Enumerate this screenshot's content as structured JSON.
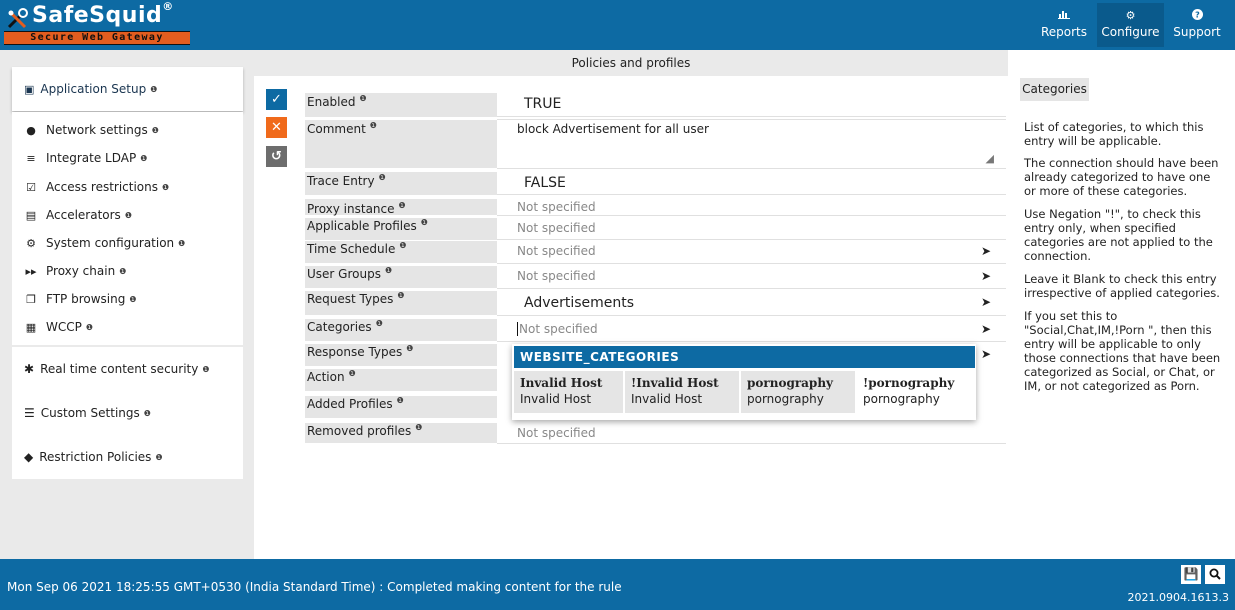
{
  "header": {
    "brand": "SafeSquid",
    "brand_mark": "®",
    "tagline": "Secure Web Gateway",
    "nav": [
      {
        "label": "Reports",
        "icon": "chart-icon"
      },
      {
        "label": "Configure",
        "icon": "gears-icon"
      },
      {
        "label": "Support",
        "icon": "question-icon"
      }
    ]
  },
  "sidebar": {
    "section_application": "Application Setup",
    "items": [
      {
        "label": "Network settings",
        "icon": "globe-icon"
      },
      {
        "label": "Integrate LDAP",
        "icon": "list-icon"
      },
      {
        "label": "Access restrictions",
        "icon": "checkbox-icon"
      },
      {
        "label": "Accelerators",
        "icon": "server-icon"
      },
      {
        "label": "System configuration",
        "icon": "gear-icon"
      },
      {
        "label": "Proxy chain",
        "icon": "forward-icon"
      },
      {
        "label": "FTP browsing",
        "icon": "files-icon"
      },
      {
        "label": "WCCP",
        "icon": "keyboard-icon"
      }
    ],
    "section_realtime": "Real time content security",
    "section_custom": "Custom Settings",
    "section_restriction": "Restriction Policies",
    "info_mark": "❶"
  },
  "main": {
    "title": "Policies and profiles",
    "fields": {
      "enabled": {
        "label": "Enabled",
        "value": "TRUE"
      },
      "comment": {
        "label": "Comment",
        "value": "block Advertisement for all user"
      },
      "trace": {
        "label": "Trace Entry",
        "value": "FALSE"
      },
      "proxy_instance": {
        "label": "Proxy instance",
        "value": "Not specified"
      },
      "applicable_profiles": {
        "label": "Applicable Profiles",
        "value": "Not specified"
      },
      "time_schedule": {
        "label": "Time Schedule",
        "value": "Not specified"
      },
      "user_groups": {
        "label": "User Groups",
        "value": "Not specified"
      },
      "request_types": {
        "label": "Request Types",
        "value": "Advertisements"
      },
      "categories": {
        "label": "Categories",
        "placeholder": "Not specified"
      },
      "response_types": {
        "label": "Response Types",
        "value": ""
      },
      "action": {
        "label": "Action",
        "value": ""
      },
      "added_profiles": {
        "label": "Added Profiles",
        "value": ""
      },
      "removed_profiles": {
        "label": "Removed profiles",
        "value": "Not specified"
      }
    },
    "dropdown": {
      "header": "WEBSITE_CATEGORIES",
      "options": [
        {
          "title": "Invalid Host",
          "subtitle": "Invalid Host"
        },
        {
          "title": "!Invalid Host",
          "subtitle": "Invalid Host"
        },
        {
          "title": "pornography",
          "subtitle": "pornography"
        },
        {
          "title": "!pornography",
          "subtitle": "pornography"
        }
      ]
    }
  },
  "help": {
    "tab": "Categories",
    "paragraphs": [
      "List of categories, to which this entry will be applicable.",
      "The connection should have been already categorized to have one or more of these categories.",
      "Use Negation \"!\", to check this entry only, when specified categories are not applied to the connection.",
      "Leave it Blank to check this entry irrespective of applied categories.",
      "If you set this to \"Social,Chat,IM,!Porn \", then this entry will be applicable to only those connections that have been categorized as Social, or Chat, or IM, or not categorized as Porn."
    ]
  },
  "footer": {
    "status": "Mon Sep 06 2021 18:25:55 GMT+0530 (India Standard Time) : Completed making content for the rule",
    "version": "2021.0904.1613.3"
  },
  "colors": {
    "brand_blue": "#0d6aa3",
    "brand_orange": "#e35d1f",
    "cancel_orange": "#f06a1b",
    "panel_grey": "#eaeaea"
  }
}
